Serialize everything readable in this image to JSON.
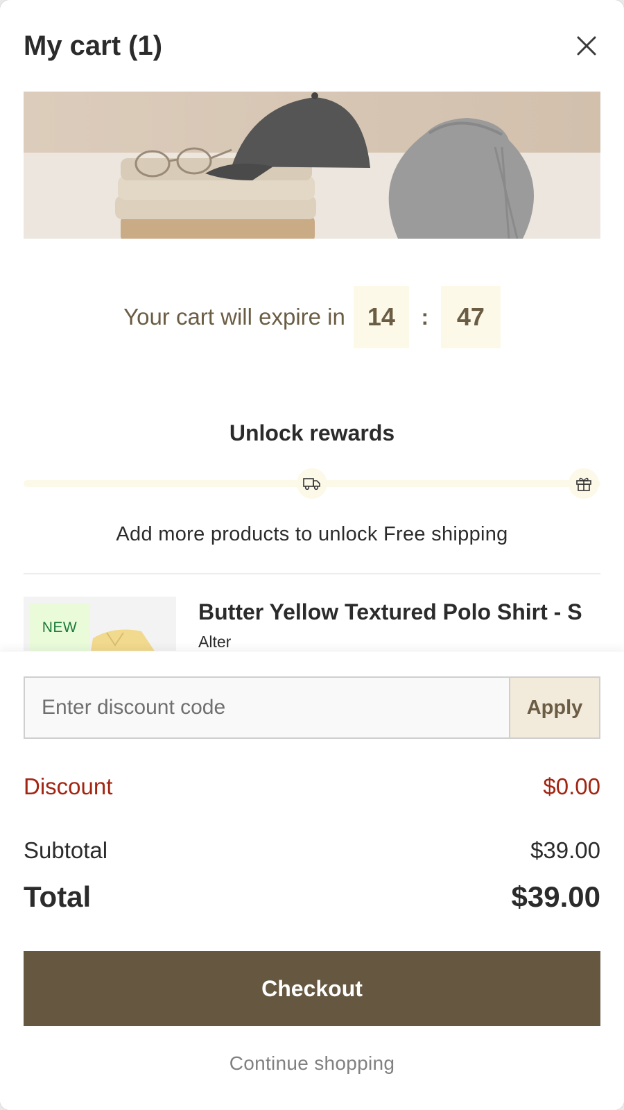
{
  "header": {
    "title": "My cart (1)",
    "close_icon": "close-icon"
  },
  "banner": {
    "alt": "Folded shirts with glasses, cap and drawstring bag"
  },
  "timer": {
    "label": "Your cart will expire in",
    "minutes": "14",
    "separator": ":",
    "seconds": "47"
  },
  "rewards": {
    "title": "Unlock rewards",
    "progress": 0,
    "milestones": [
      {
        "icon": "truck-icon"
      },
      {
        "icon": "gift-icon"
      }
    ],
    "message": "Add more products to unlock Free shipping"
  },
  "cart_item": {
    "badge": "NEW",
    "name": "Butter Yellow Textured Polo Shirt - S",
    "brand": "Alter"
  },
  "discount": {
    "placeholder": "Enter discount code",
    "value": "",
    "apply_label": "Apply"
  },
  "summary": {
    "discount_label": "Discount",
    "discount_value": "$0.00",
    "subtotal_label": "Subtotal",
    "subtotal_value": "$39.00",
    "total_label": "Total",
    "total_value": "$39.00"
  },
  "actions": {
    "checkout_label": "Checkout",
    "continue_label": "Continue shopping"
  },
  "colors": {
    "accent": "#655740",
    "timer_bg": "#fdf9e8",
    "discount_red": "#a22512",
    "badge_bg": "#e9fbd9",
    "badge_text": "#1a7a3a",
    "apply_bg": "#f2eadb"
  }
}
